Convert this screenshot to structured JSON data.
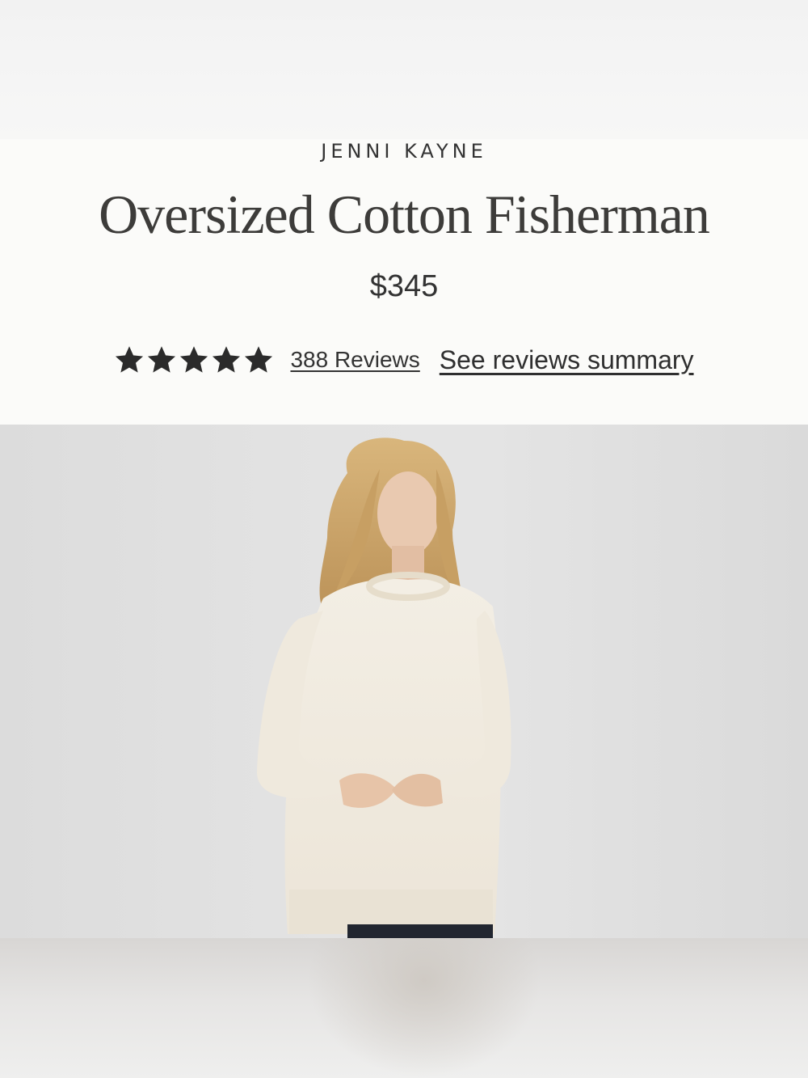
{
  "product": {
    "brand": "JENNI KAYNE",
    "title": "Oversized Cotton Fisherman",
    "price": "$345",
    "rating": {
      "stars": 5,
      "max_stars": 5,
      "reviews_link": "388 Reviews",
      "summary_link": "See reviews summary"
    }
  },
  "image": {
    "alt": "Model wearing cream oversized cotton fisherman sweater"
  },
  "colors": {
    "header_bg": "#fbfbf9",
    "text": "#333333",
    "sweater": "#f1ebdf",
    "hair": "#c9a46a",
    "backdrop": "#e1e1e1"
  }
}
